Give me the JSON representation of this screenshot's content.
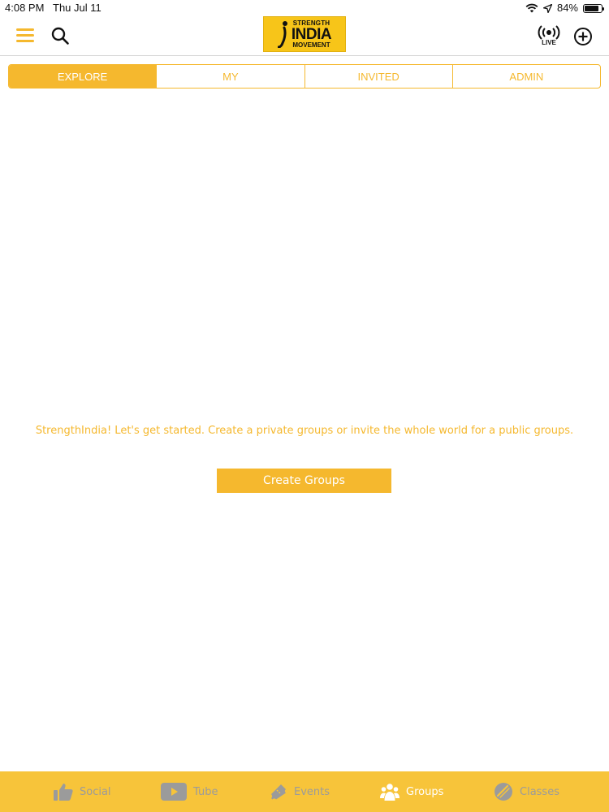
{
  "status_bar": {
    "time": "4:08 PM",
    "date": "Thu Jul 11",
    "battery_percent": "84%",
    "battery_level": 0.84,
    "wifi_icon": "wifi-icon",
    "location_icon": "location-arrow-icon"
  },
  "header": {
    "logo": {
      "line1": "STRENGTH",
      "line2": "INDIA",
      "line3": "MOVEMENT"
    },
    "live_label": "LIVE",
    "icons": [
      "hamburger-menu-icon",
      "search-icon",
      "live-broadcast-icon",
      "add-circle-icon"
    ]
  },
  "tabs": [
    {
      "label": "EXPLORE",
      "active": true
    },
    {
      "label": "MY",
      "active": false
    },
    {
      "label": "INVITED",
      "active": false
    },
    {
      "label": "ADMIN",
      "active": false
    }
  ],
  "main": {
    "empty_message": "StrengthIndia! Let's get started. Create a private groups or invite the whole world for a public groups.",
    "create_button": "Create Groups"
  },
  "bottom_nav": [
    {
      "label": "Social",
      "icon": "thumbs-up-icon",
      "active": false
    },
    {
      "label": "Tube",
      "icon": "play-video-icon",
      "active": false
    },
    {
      "label": "Events",
      "icon": "ticket-icon",
      "active": false
    },
    {
      "label": "Groups",
      "icon": "users-group-icon",
      "active": true
    },
    {
      "label": "Classes",
      "icon": "classes-icon",
      "active": false
    }
  ],
  "colors": {
    "accent": "#f5b82e",
    "logo_bg": "#f7c519",
    "nav_bg": "#f7c43a",
    "nav_inactive": "#9b9b9b",
    "nav_active": "#ffffff"
  }
}
